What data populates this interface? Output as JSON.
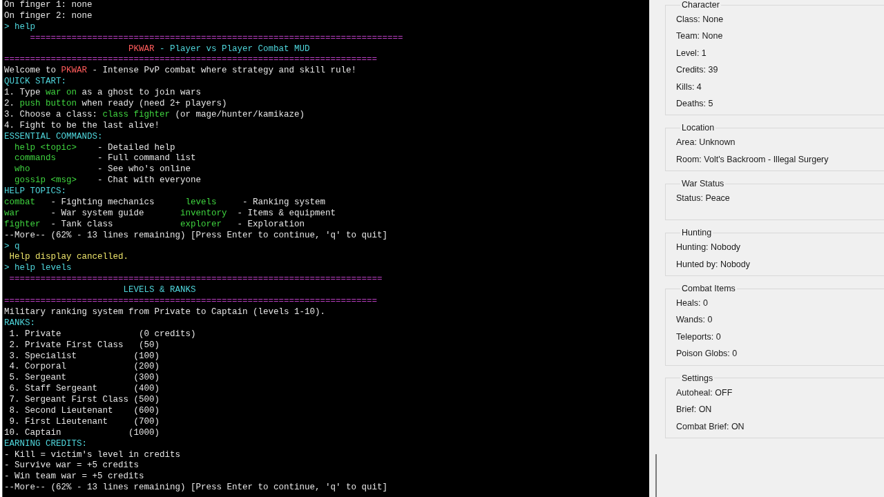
{
  "terminal": {
    "lines": [
      {
        "kind": "output",
        "text": "On finger 1: none"
      },
      {
        "kind": "output",
        "text": "On finger 2: none"
      },
      {
        "kind": "prompt",
        "text": "> help"
      },
      {
        "kind": "rule",
        "text": "     ========================================================================"
      },
      {
        "kind": "heading",
        "parts": [
          {
            "text": "                        PKWAR",
            "kind": "brand"
          },
          {
            "text": " - Player vs Player Combat MUD"
          }
        ]
      },
      {
        "kind": "rule",
        "text": "========================================================================"
      },
      {
        "kind": "output",
        "parts": [
          {
            "text": "Welcome to "
          },
          {
            "text": "PKWAR",
            "kind": "brand"
          },
          {
            "text": " - Intense PvP combat where strategy and skill rule!"
          }
        ]
      },
      {
        "kind": "heading",
        "text": "QUICK START:"
      },
      {
        "kind": "output",
        "parts": [
          {
            "text": "1. Type "
          },
          {
            "text": "war on",
            "kind": "command"
          },
          {
            "text": " as a ghost to join wars"
          }
        ]
      },
      {
        "kind": "output",
        "parts": [
          {
            "text": "2. "
          },
          {
            "text": "push button",
            "kind": "command"
          },
          {
            "text": " when ready (need 2+ players)"
          }
        ]
      },
      {
        "kind": "output",
        "parts": [
          {
            "text": "3. Choose a class: "
          },
          {
            "text": "class fighter",
            "kind": "command"
          },
          {
            "text": " (or mage/hunter/kamikaze)"
          }
        ]
      },
      {
        "kind": "output",
        "text": "4. Fight to be the last alive!"
      },
      {
        "kind": "heading",
        "text": "ESSENTIAL COMMANDS:"
      },
      {
        "kind": "output",
        "parts": [
          {
            "text": "  help <topic>",
            "kind": "command"
          },
          {
            "text": "    - Detailed help"
          }
        ]
      },
      {
        "kind": "output",
        "parts": [
          {
            "text": "  commands",
            "kind": "command"
          },
          {
            "text": "        - Full command list"
          }
        ]
      },
      {
        "kind": "output",
        "parts": [
          {
            "text": "  who",
            "kind": "command"
          },
          {
            "text": "             - See who's online"
          }
        ]
      },
      {
        "kind": "output",
        "parts": [
          {
            "text": "  gossip <msg>",
            "kind": "command"
          },
          {
            "text": "    - Chat with everyone"
          }
        ]
      },
      {
        "kind": "heading",
        "text": "HELP TOPICS:"
      },
      {
        "kind": "output",
        "parts": [
          {
            "text": "combat",
            "kind": "command"
          },
          {
            "text": "   - Fighting mechanics      "
          },
          {
            "text": "levels",
            "kind": "command"
          },
          {
            "text": "     - Ranking system"
          }
        ]
      },
      {
        "kind": "output",
        "parts": [
          {
            "text": "war",
            "kind": "command"
          },
          {
            "text": "      - War system guide       "
          },
          {
            "text": "inventory",
            "kind": "command"
          },
          {
            "text": "  - Items & equipment"
          }
        ]
      },
      {
        "kind": "output",
        "parts": [
          {
            "text": "fighter",
            "kind": "command"
          },
          {
            "text": "  - Tank class             "
          },
          {
            "text": "explorer",
            "kind": "command"
          },
          {
            "text": "   - Exploration"
          }
        ]
      },
      {
        "kind": "output",
        "text": "--More-- (62% - 13 lines remaining) [Press Enter to continue, 'q' to quit]"
      },
      {
        "kind": "prompt",
        "text": "> q"
      },
      {
        "kind": "notice",
        "text": " Help display cancelled."
      },
      {
        "kind": "prompt",
        "text": "> help levels"
      },
      {
        "kind": "rule",
        "text": " ========================================================================"
      },
      {
        "kind": "heading",
        "text": "                       LEVELS & RANKS"
      },
      {
        "kind": "rule",
        "text": "========================================================================"
      },
      {
        "kind": "output",
        "text": "Military ranking system from Private to Captain (levels 1-10)."
      },
      {
        "kind": "heading",
        "text": "RANKS:"
      },
      {
        "kind": "output",
        "text": " 1. Private               (0 credits)"
      },
      {
        "kind": "output",
        "text": " 2. Private First Class   (50)"
      },
      {
        "kind": "output",
        "text": " 3. Specialist           (100)"
      },
      {
        "kind": "output",
        "text": " 4. Corporal             (200)"
      },
      {
        "kind": "output",
        "text": " 5. Sergeant             (300)"
      },
      {
        "kind": "output",
        "text": " 6. Staff Sergeant       (400)"
      },
      {
        "kind": "output",
        "text": " 7. Sergeant First Class (500)"
      },
      {
        "kind": "output",
        "text": " 8. Second Lieutenant    (600)"
      },
      {
        "kind": "output",
        "text": " 9. First Lieutenant     (700)"
      },
      {
        "kind": "output",
        "text": "10. Captain             (1000)"
      },
      {
        "kind": "heading",
        "text": "EARNING CREDITS:"
      },
      {
        "kind": "output",
        "text": "- Kill = victim's level in credits"
      },
      {
        "kind": "output",
        "text": "- Survive war = +5 credits"
      },
      {
        "kind": "output",
        "text": "- Win team war = +5 credits"
      },
      {
        "kind": "output",
        "text": "--More-- (62% - 13 lines remaining) [Press Enter to continue, 'q' to quit]"
      }
    ]
  },
  "side_panel": {
    "groups": [
      {
        "title": "Character",
        "items": [
          "Class: None",
          "Team: None",
          "Level: 1",
          "Credits: 39",
          "Kills: 4",
          "Deaths: 5"
        ]
      },
      {
        "title": "Location",
        "items": [
          "Area: Unknown",
          "Room: Volt's Backroom - Illegal Surgery"
        ]
      },
      {
        "title": "War Status",
        "items": [
          "Status: Peace"
        ]
      },
      {
        "title": "Hunting",
        "items": [
          "Hunting: Nobody",
          "Hunted by: Nobody"
        ]
      },
      {
        "title": "Combat Items",
        "items": [
          "Heals: 0",
          "Wands: 0",
          "Teleports: 0",
          "Poison Globs: 0"
        ]
      },
      {
        "title": "Settings",
        "items": [
          "Autoheal: OFF",
          "Brief: ON",
          "Combat Brief: ON"
        ]
      }
    ]
  }
}
